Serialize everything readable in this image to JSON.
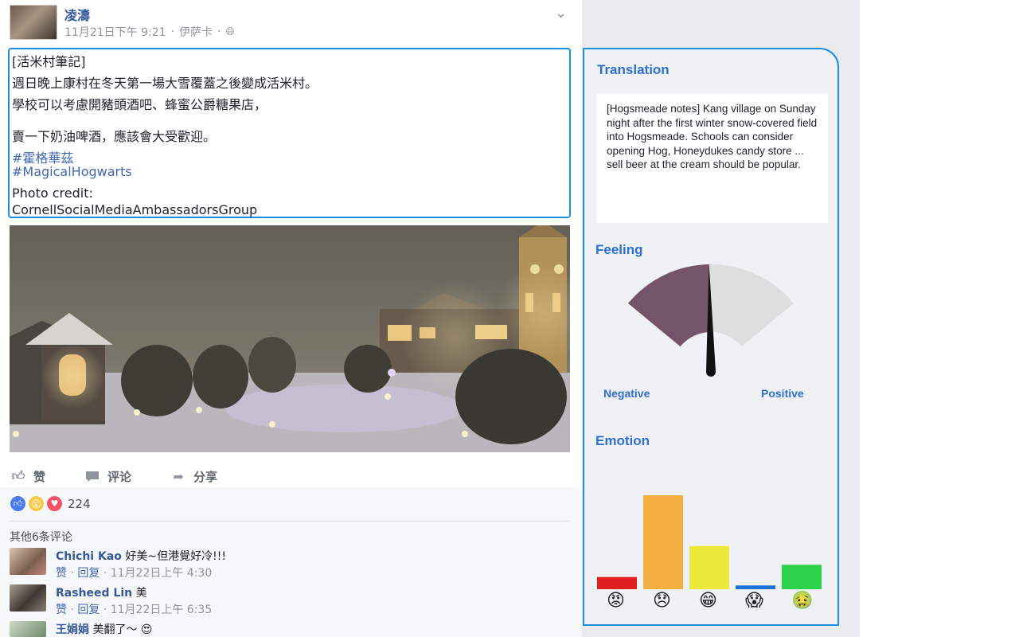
{
  "post": {
    "author": "凌濤",
    "date": "11月21日下午 9:21",
    "location": "伊萨卡",
    "lines": [
      "[活米村筆記]",
      "週日晚上康村在冬天第一場大雪覆蓋之後變成活米村。",
      "學校可以考慮開豬頭酒吧、蜂蜜公爵糖果店，",
      "賣一下奶油啤酒，應該會大受歡迎。"
    ],
    "hashtags": [
      "#霍格華茲",
      "#MagicalHogwarts"
    ],
    "credit_label": "Photo credit:",
    "credit_value": "CornellSocialMediaAmbassadorsGroup"
  },
  "actions": {
    "like": "赞",
    "comment": "评论",
    "share": "分享"
  },
  "reactions": {
    "count": "224"
  },
  "comments": {
    "more_label": "其他6条评论",
    "items": [
      {
        "name": "Chichi Kao",
        "text": "好美~但港覺好冷!!!",
        "like": "赞",
        "reply": "回复",
        "time": "11月22日上午 4:30"
      },
      {
        "name": "Rasheed Lin",
        "text": "美",
        "like": "赞",
        "reply": "回复",
        "time": "11月22日上午 6:35"
      },
      {
        "name": "王娟娟",
        "text": "美翻了～"
      }
    ]
  },
  "panel": {
    "translation_title": "Translation",
    "translation_text": "[Hogsmeade notes] Kang village on Sunday night after the first winter snow-covered field into Hogsmeade. Schools can consider opening Hog, Honeydukes candy store ... sell beer at the cream should be popular.",
    "feeling_title": "Feeling",
    "gauge_labels": {
      "negative": "Negative",
      "positive": "Positive"
    },
    "feeling_value": 0.49,
    "emotion_title": "Emotion"
  },
  "chart_data": {
    "type": "bar",
    "categories": [
      "angry",
      "sad",
      "joy",
      "fear",
      "disgust"
    ],
    "values": [
      0.13,
      1.0,
      0.46,
      0.04,
      0.26
    ],
    "colors": [
      "#e02020",
      "#f2ae40",
      "#ede83c",
      "#1d72d8",
      "#2ed24a"
    ],
    "icons": [
      "😡",
      "😞",
      "😁",
      "😱",
      "🤢"
    ]
  },
  "colors": {
    "accent": "#1b8ee0",
    "link": "#365899",
    "gauge_fill": "#745468",
    "gauge_bg": "#dedede"
  }
}
